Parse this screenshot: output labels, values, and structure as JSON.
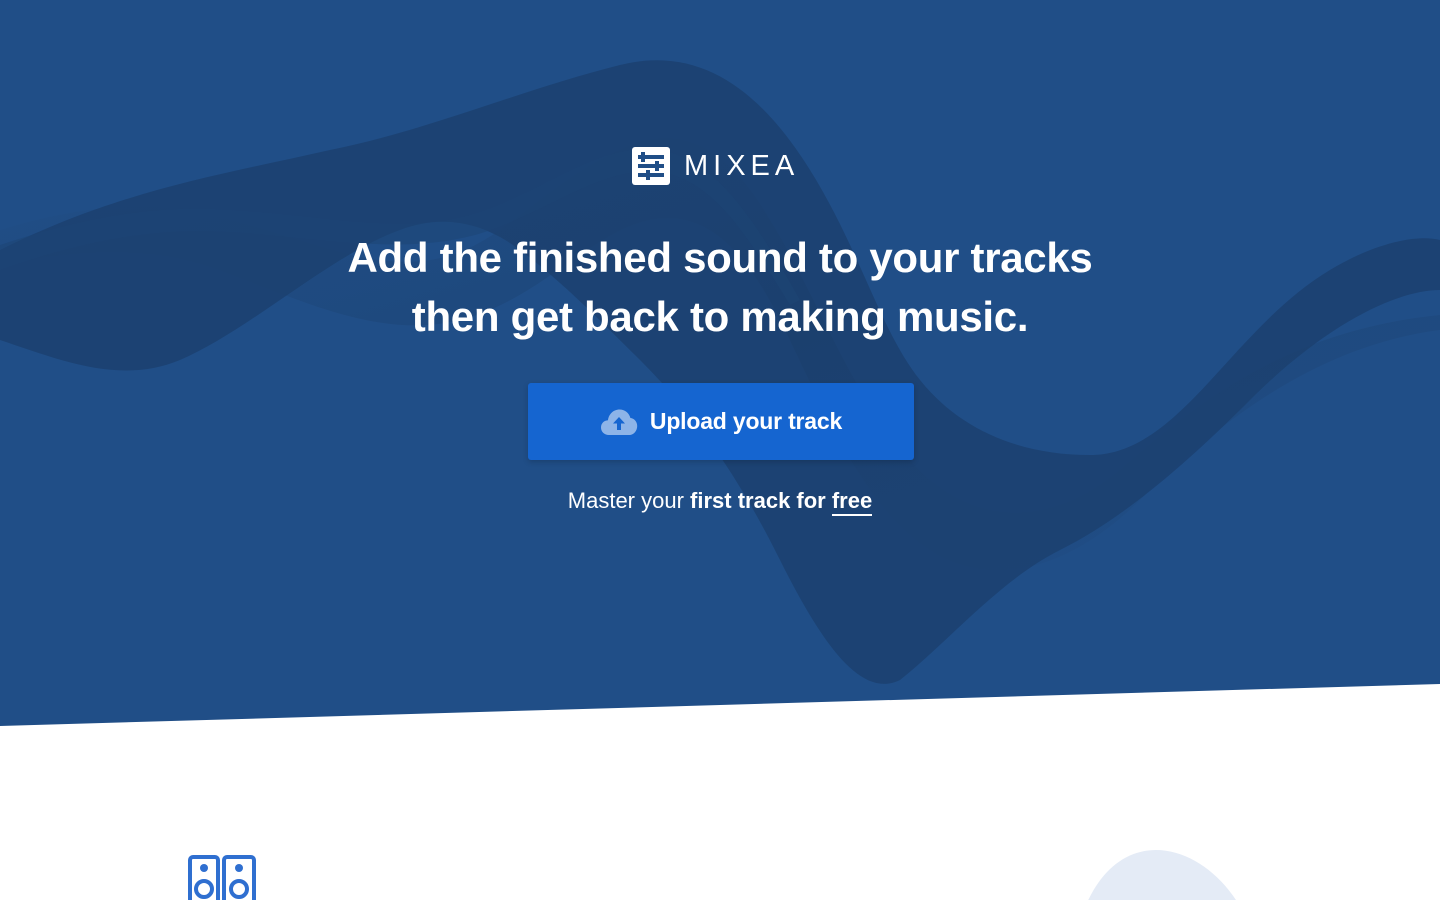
{
  "brand": {
    "name": "MIXEA",
    "icon": "mixer-sliders-icon"
  },
  "hero": {
    "headline_line1": "Add the finished sound to your tracks",
    "headline_line2": "then get back to making music.",
    "upload_button": {
      "label": "Upload your track",
      "icon": "cloud-upload-icon"
    },
    "subline": {
      "part1": "Master your ",
      "part2": "first track for ",
      "link": "free"
    }
  },
  "colors": {
    "hero_background": "#204e87",
    "wave_dark": "#1a3c68",
    "button": "#1565d0",
    "feature_icon": "#2f6fd0",
    "blob": "#e4ebf6"
  },
  "feature_section": {
    "icon": "speakers-icon"
  }
}
